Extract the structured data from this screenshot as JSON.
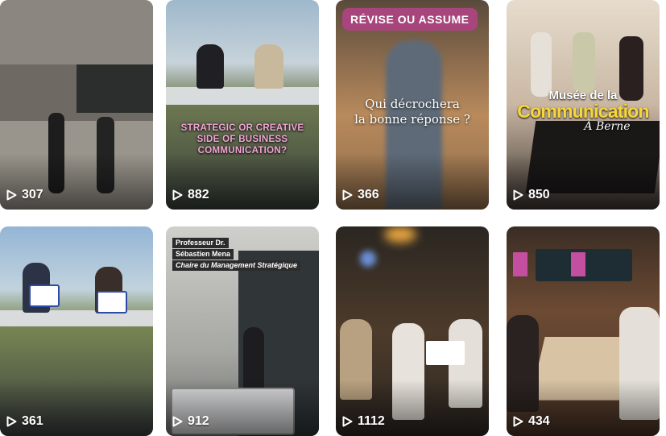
{
  "grid": {
    "items": [
      {
        "views": "307",
        "scene": "building-interior"
      },
      {
        "views": "882",
        "scene": "outdoor-table",
        "caption": "STRATEGIC OR CREATIVE SIDE OF BUSINESS COMMUNICATION?"
      },
      {
        "views": "366",
        "scene": "lecture-hall",
        "badge": "RÉVISE OU ASSUME",
        "caption_line1": "Qui décrochera",
        "caption_line2": "la bonne réponse ?"
      },
      {
        "views": "850",
        "scene": "museum",
        "title_line1": "Musée de la",
        "title_line2": "Communication",
        "title_line3": "À Berne"
      },
      {
        "views": "361",
        "scene": "outdoor-signs"
      },
      {
        "views": "912",
        "scene": "foosball",
        "label_line1": "Professeur Dr.",
        "label_line2": "Sébastien Mena",
        "label_line3": "Chaire du Management Stratégique"
      },
      {
        "views": "1112",
        "scene": "party"
      },
      {
        "views": "434",
        "scene": "restaurant"
      }
    ]
  },
  "icons": {
    "views": "play-icon"
  },
  "colors": {
    "badge": "#a8457c",
    "caption_pink": "#f3a6d5",
    "museum_yellow": "#f6d63a"
  }
}
